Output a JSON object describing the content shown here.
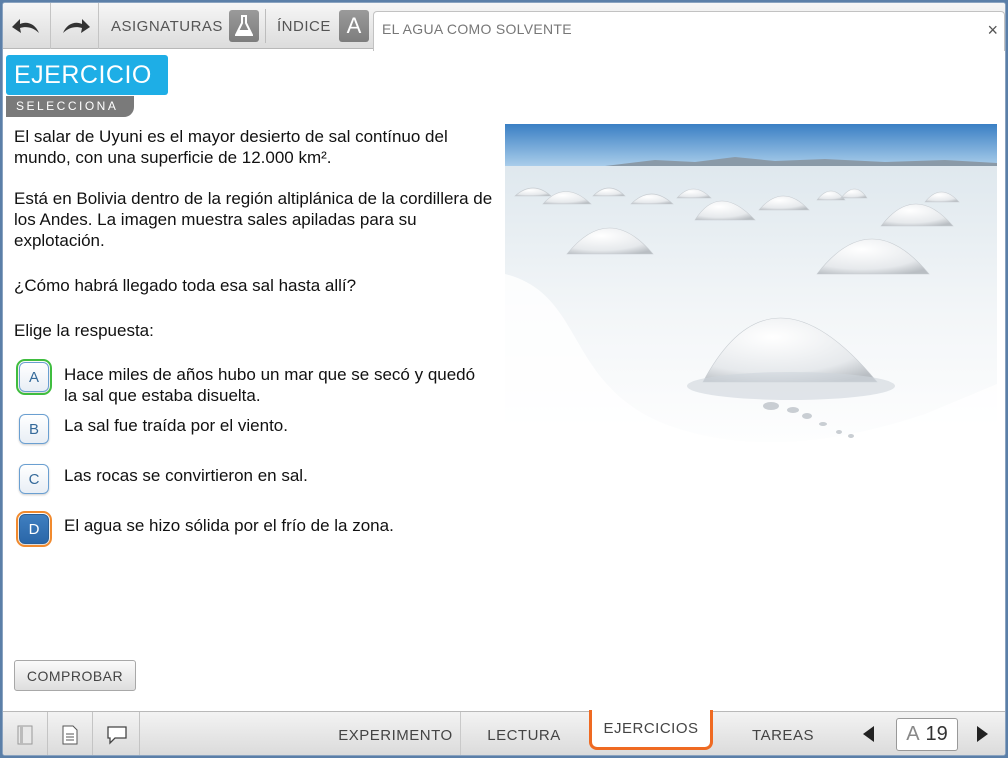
{
  "toolbar": {
    "subjects_label": "ASIGNATURAS",
    "index_label": "ÍNDICE",
    "index_letter": "A",
    "document_title": "EL AGUA COMO SOLVENTE",
    "close": "×"
  },
  "exercise": {
    "header": "EJERCICIO",
    "mode": "SELECCIONA",
    "paragraphs": [
      "El salar de Uyuni es el mayor desierto de sal contínuo del mundo, con una superficie de 12.000 km².",
      "Está en Bolivia dentro de la región altiplánica de la cordillera de los Andes. La imagen muestra sales apiladas para su explotación.",
      "¿Cómo habrá llegado toda esa sal hasta allí?",
      "Elige la respuesta:"
    ],
    "options": [
      {
        "key": "A",
        "text": "Hace miles de años hubo un mar que se secó y quedó la sal que estaba disuelta."
      },
      {
        "key": "B",
        "text": "La sal fue traída por el viento."
      },
      {
        "key": "C",
        "text": "Las rocas se convirtieron en sal."
      },
      {
        "key": "D",
        "text": "El agua se hizo sólida por el frío de la zona."
      }
    ],
    "check_button": "COMPROBAR"
  },
  "bottom_tabs": [
    "EXPERIMENTO",
    "LECTURA",
    "EJERCICIOS",
    "TAREAS"
  ],
  "pager": {
    "letter": "A",
    "page": "19"
  },
  "colors": {
    "accent_blue": "#1eaee6",
    "active_tab": "#ef6a22",
    "correct_outline": "#3fbd3f"
  }
}
